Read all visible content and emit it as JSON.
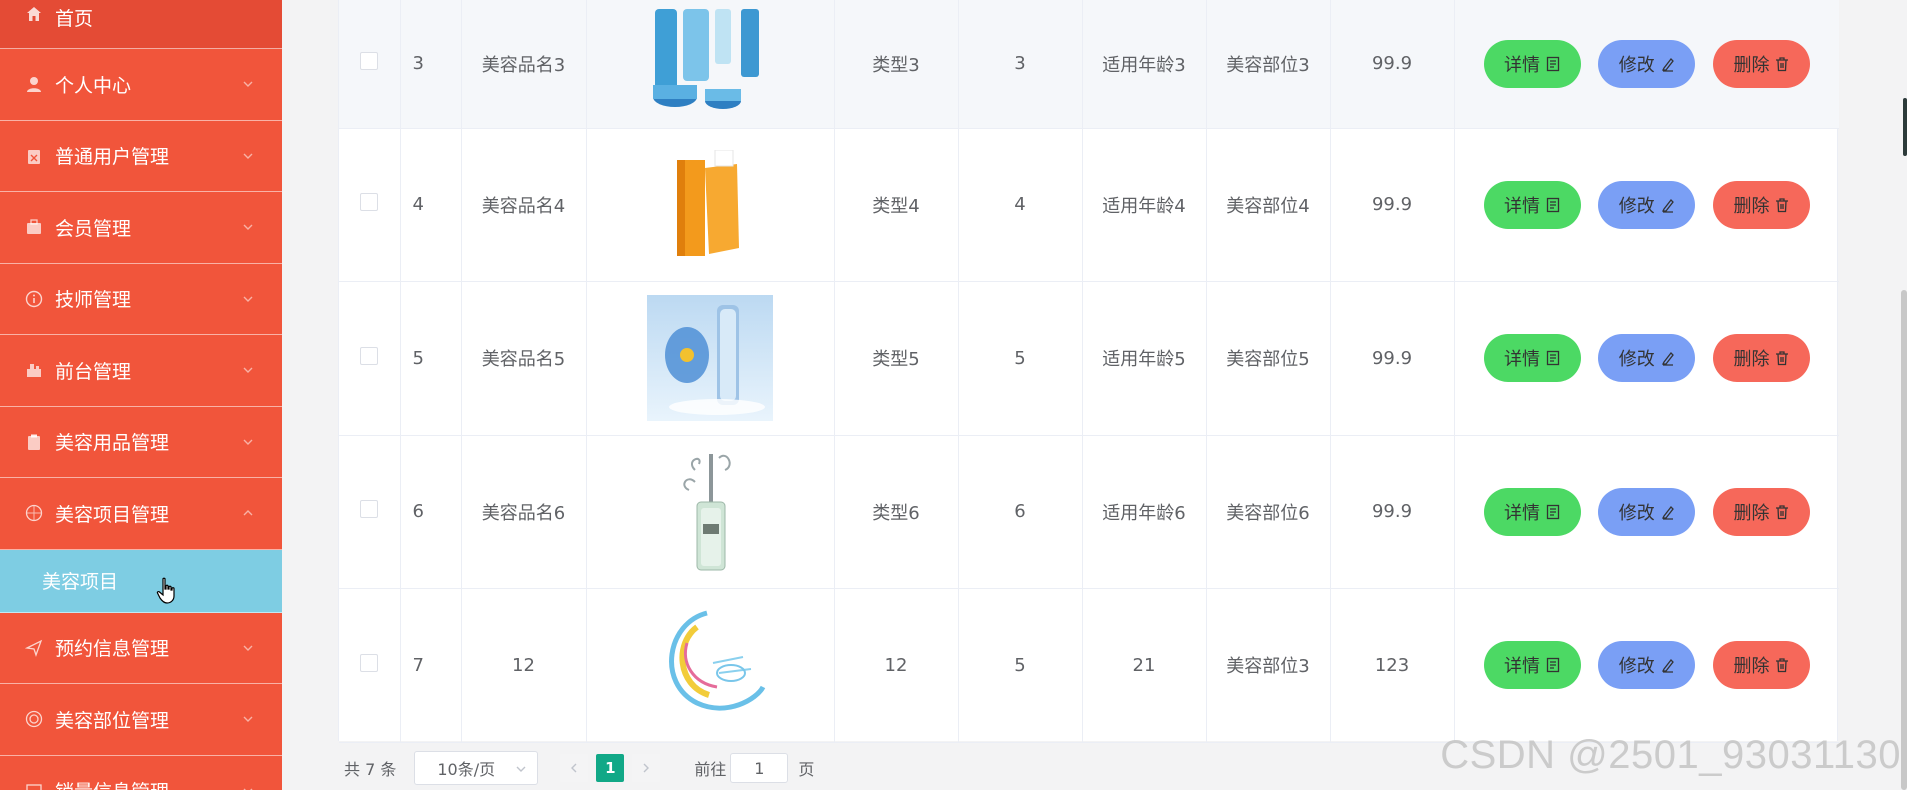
{
  "sidebar": {
    "items": [
      {
        "label": "首页",
        "icon": "home-icon"
      },
      {
        "label": "个人中心",
        "icon": "user-icon"
      },
      {
        "label": "普通用户管理",
        "icon": "clipboard-icon"
      },
      {
        "label": "会员管理",
        "icon": "briefcase-icon"
      },
      {
        "label": "技师管理",
        "icon": "info-circle-icon"
      },
      {
        "label": "前台管理",
        "icon": "toolbox-icon"
      },
      {
        "label": "美容用品管理",
        "icon": "clipboard-icon"
      },
      {
        "label": "美容项目管理",
        "icon": "compass-icon"
      },
      {
        "label": "预约信息管理",
        "icon": "send-icon"
      },
      {
        "label": "美容部位管理",
        "icon": "radio-circle-icon"
      },
      {
        "label": "销量信息管理",
        "icon": "chart-icon"
      }
    ],
    "active_sub": {
      "label": "美容项目"
    },
    "colors": {
      "sidebar_bg": "#f1553b",
      "submenu_bg": "#7ecde3"
    }
  },
  "table": {
    "rows": [
      {
        "index": "3",
        "name": "美容品名3",
        "type": "类型3",
        "num": "3",
        "age": "适用年龄3",
        "part": "美容部位3",
        "price": "99.9",
        "image": "blue skincare set"
      },
      {
        "index": "4",
        "name": "美容品名4",
        "type": "类型4",
        "num": "4",
        "age": "适用年龄4",
        "part": "美容部位4",
        "price": "99.9",
        "image": "orange cream tube"
      },
      {
        "index": "5",
        "name": "美容品名5",
        "type": "类型5",
        "num": "5",
        "age": "适用年龄5",
        "part": "美容部位5",
        "price": "99.9",
        "image": "blue serum bottle with flower"
      },
      {
        "index": "6",
        "name": "美容品名6",
        "type": "类型6",
        "num": "6",
        "age": "适用年龄6",
        "part": "美容部位6",
        "price": "99.9",
        "image": "clear serum bottle with splash"
      },
      {
        "index": "7",
        "name": "12",
        "type": "12",
        "num": "5",
        "age": "21",
        "part": "美容部位3",
        "price": "123",
        "image": "colorful swirl logo"
      }
    ],
    "actions": {
      "detail": "详情",
      "edit": "修改",
      "delete": "删除"
    },
    "colors": {
      "detail": "#4cd964",
      "edit": "#7a9ff5",
      "delete": "#f6685a"
    }
  },
  "pagination": {
    "total": "共 7 条",
    "page_size": "10条/页",
    "current_page": "1",
    "goto_label": "前往",
    "goto_value": "1",
    "page_suffix": "页"
  },
  "watermark": "CSDN @2501_93031130"
}
